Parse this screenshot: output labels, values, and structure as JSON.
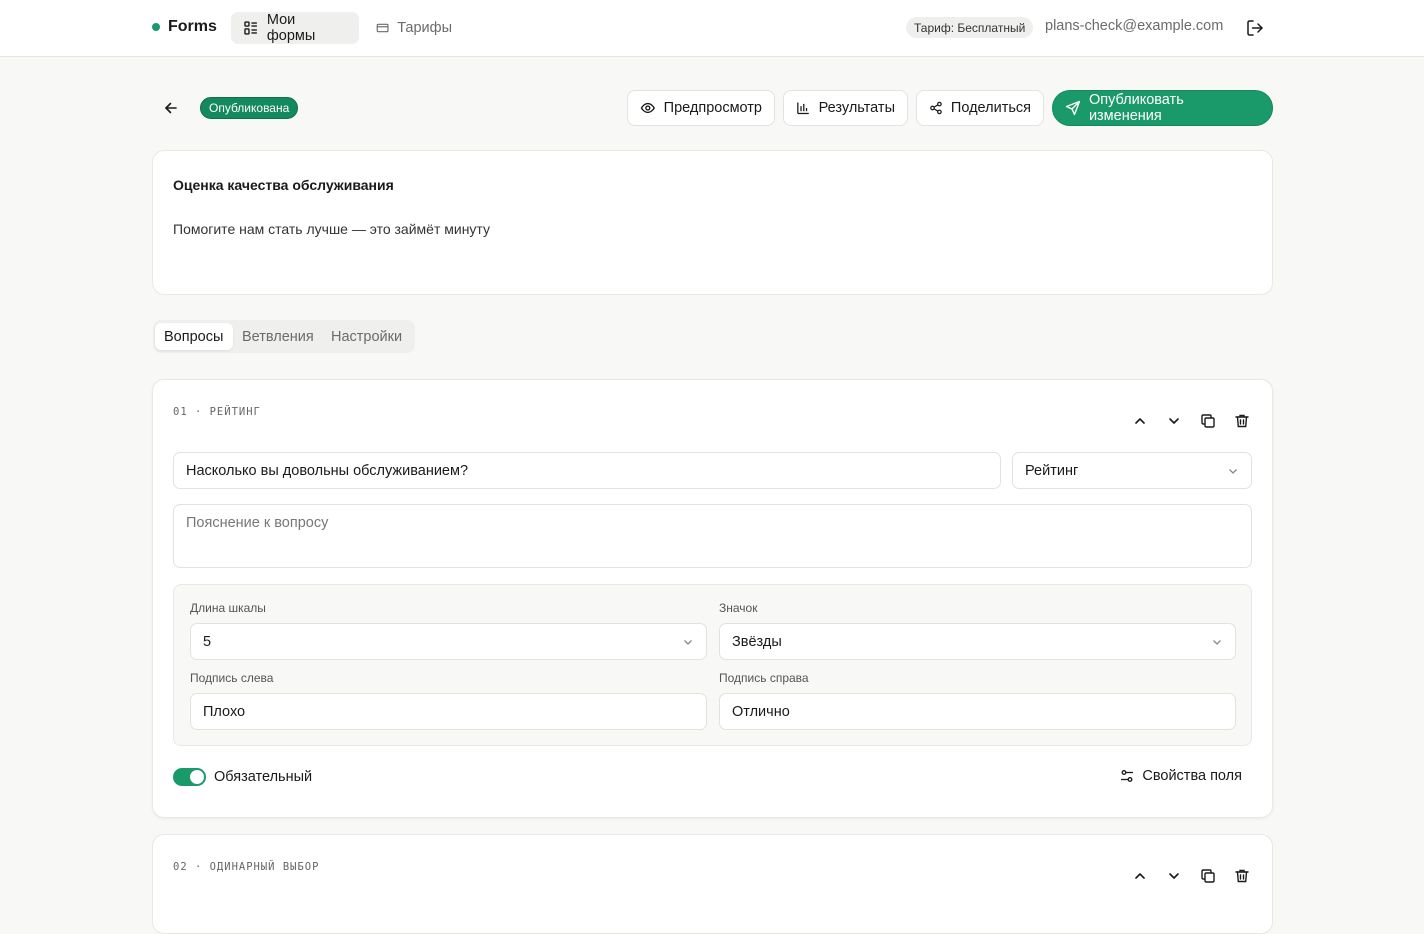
{
  "nav": {
    "brand": "Forms",
    "my_forms": "Мои формы",
    "plans": "Тарифы",
    "plan_badge": "Тариф: Бесплатный",
    "email": "plans-check@example.com",
    "brand_color": "#1a9a6b"
  },
  "toolbar": {
    "status": "Опубликована",
    "preview": "Предпросмотр",
    "results": "Результаты",
    "share": "Поделиться",
    "publish": "Опубликовать изменения"
  },
  "form": {
    "title": "Оценка качества обслуживания",
    "description": "Помогите нам стать лучше — это займёт минуту"
  },
  "tabs": [
    {
      "label": "Вопросы",
      "active": true
    },
    {
      "label": "Ветвления",
      "active": false
    },
    {
      "label": "Настройки",
      "active": false
    }
  ],
  "questions": [
    {
      "label": "01 · РЕЙТИНГ",
      "text": "Насколько вы довольны обслуживанием?",
      "type": "Рейтинг",
      "hint_placeholder": "Пояснение к вопросу",
      "scale_length_label": "Длина шкалы",
      "scale_length": "5",
      "icon_label": "Значок",
      "icon_value": "Звёзды",
      "left_caption_label": "Подпись слева",
      "left_caption": "Плохо",
      "right_caption_label": "Подпись справа",
      "right_caption": "Отлично",
      "required_label": "Обязательный",
      "required": true,
      "field_props": "Свойства поля"
    },
    {
      "label": "02 · ОДИНАРНЫЙ ВЫБОР"
    }
  ]
}
